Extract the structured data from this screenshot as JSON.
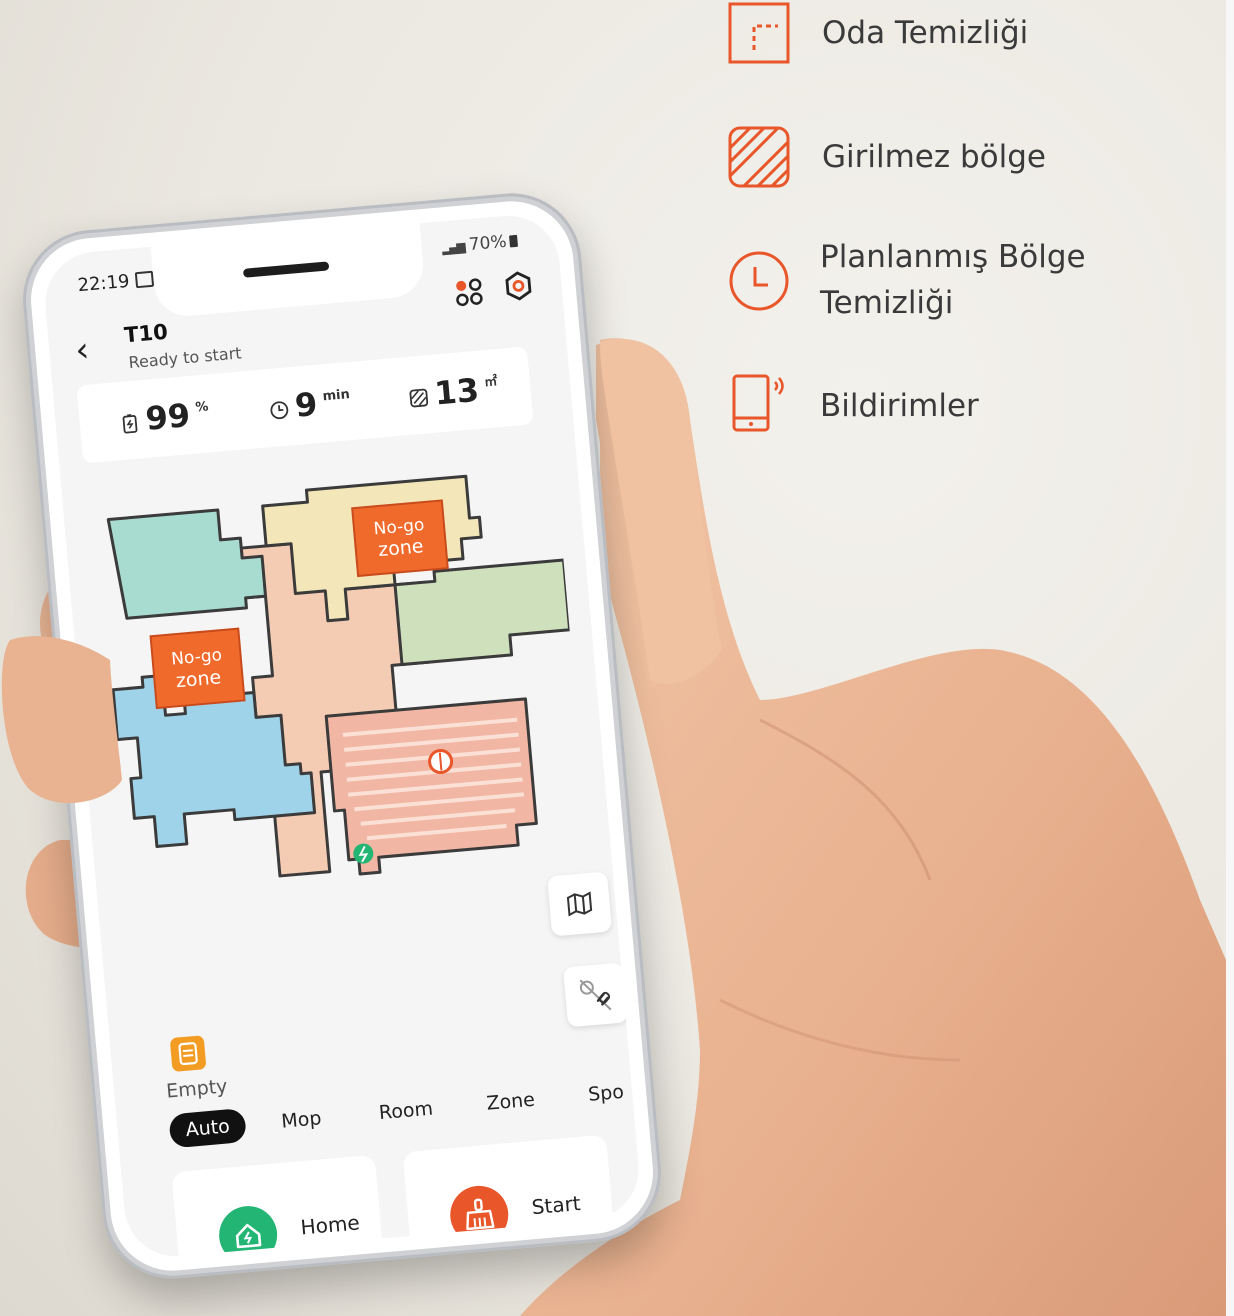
{
  "features": [
    {
      "icon": "room-corner-icon",
      "label": "Oda Temizliği"
    },
    {
      "icon": "hatched-square-icon",
      "label": "Girilmez bölge"
    },
    {
      "icon": "clock-icon",
      "label_lines": [
        "Planlanmış Bölge",
        "Temizliği"
      ]
    },
    {
      "icon": "phone-notification-icon",
      "label": "Bildirimler"
    }
  ],
  "phone": {
    "status_bar": {
      "time": "22:19",
      "battery": "70%"
    },
    "header": {
      "device_name": "T10",
      "status": "Ready to start"
    },
    "stats": {
      "battery": {
        "value": "99",
        "unit": "%"
      },
      "time": {
        "value": "9",
        "unit": "min"
      },
      "area": {
        "value": "13",
        "unit": "㎡"
      }
    },
    "map": {
      "zones": [
        {
          "line1": "No-go",
          "line2": "zone"
        },
        {
          "line1": "No-go",
          "line2": "zone"
        }
      ]
    },
    "water_tank": {
      "label": "Empty"
    },
    "modes": [
      "Auto",
      "Mop",
      "Room",
      "Zone",
      "Spo"
    ],
    "active_mode": "Auto",
    "actions": {
      "home": "Home",
      "start": "Start"
    }
  },
  "colors": {
    "accent": "#e8562a",
    "home_green": "#22b573",
    "water_orange": "#f39c23",
    "room_teal": "#a9dcd0",
    "room_blue": "#9fd3ea",
    "room_green": "#cfe0bd",
    "room_yellow": "#f3e6b8",
    "room_peach": "#f4cbb3"
  }
}
